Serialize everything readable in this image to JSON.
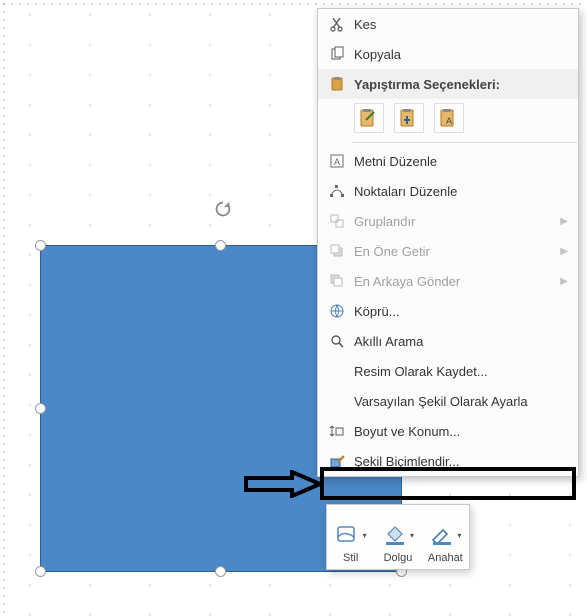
{
  "shape": {
    "fill": "#4a88c7",
    "border": "#2f5f93"
  },
  "context_menu": {
    "cut": {
      "label": "Kes"
    },
    "copy": {
      "label": "Kopyala"
    },
    "paste_header": {
      "label": "Yapıştırma Seçenekleri:"
    },
    "edit_text": {
      "label": "Metni Düzenle"
    },
    "edit_points": {
      "label": "Noktaları Düzenle"
    },
    "group": {
      "label": "Gruplandır"
    },
    "bring_front": {
      "label": "En Öne Getir"
    },
    "send_back": {
      "label": "En Arkaya Gönder"
    },
    "hyperlink": {
      "label": "Köprü..."
    },
    "smart_lookup": {
      "label": "Akıllı Arama"
    },
    "save_as_pic": {
      "label": "Resim Olarak Kaydet..."
    },
    "set_default": {
      "label": "Varsayılan Şekil Olarak Ayarla"
    },
    "size_position": {
      "label": "Boyut ve Konum..."
    },
    "format_shape": {
      "label": "Şekil Biçimlendir..."
    }
  },
  "mini_toolbar": {
    "style": {
      "label": "Stil"
    },
    "fill": {
      "label": "Dolgu"
    },
    "outline": {
      "label": "Anahat"
    }
  }
}
